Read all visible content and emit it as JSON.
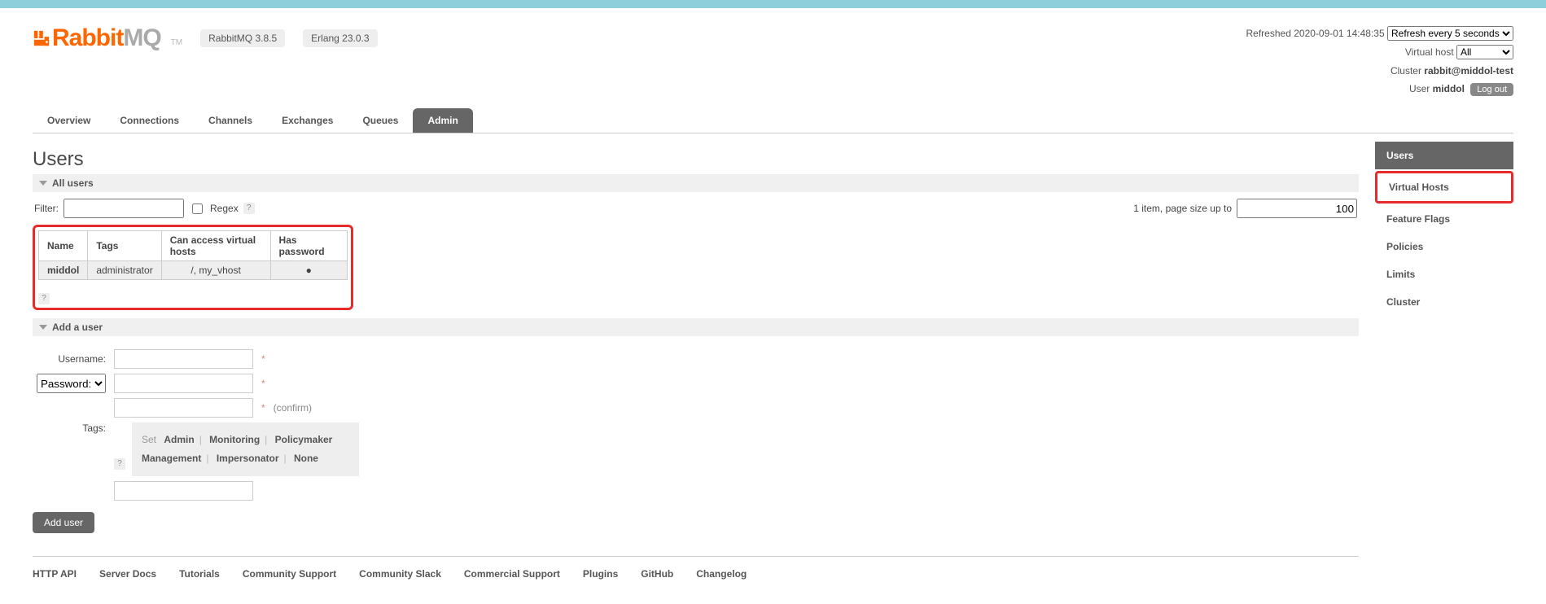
{
  "brand": {
    "rabbit": "Rabbit",
    "mq": "MQ",
    "tm": "TM"
  },
  "versions": {
    "rabbit": "RabbitMQ 3.8.5",
    "erlang": "Erlang 23.0.3"
  },
  "header": {
    "refreshed_label": "Refreshed",
    "refreshed_time": "2020-09-01 14:48:35",
    "refresh_select": "Refresh every 5 seconds",
    "vhost_label": "Virtual host",
    "vhost_value": "All",
    "cluster_label": "Cluster",
    "cluster_value": "rabbit@middol-test",
    "user_label": "User",
    "user_value": "middol",
    "logout": "Log out"
  },
  "nav": {
    "overview": "Overview",
    "connections": "Connections",
    "channels": "Channels",
    "exchanges": "Exchanges",
    "queues": "Queues",
    "admin": "Admin"
  },
  "page_title": "Users",
  "all_users": {
    "title": "All users",
    "filter_label": "Filter:",
    "regex_label": "Regex",
    "count_text": "1 item, page size up to",
    "page_size": "100",
    "cols": {
      "name": "Name",
      "tags": "Tags",
      "vhosts": "Can access virtual hosts",
      "pwd": "Has password"
    },
    "rows": [
      {
        "name": "middol",
        "tags": "administrator",
        "vhosts": "/, my_vhost",
        "pwd": "●"
      }
    ]
  },
  "add_user": {
    "title": "Add a user",
    "username_label": "Username:",
    "password_option": "Password:",
    "confirm_label": "(confirm)",
    "tags_label": "Tags:",
    "set_label": "Set",
    "opts": {
      "admin": "Admin",
      "monitoring": "Monitoring",
      "policymaker": "Policymaker",
      "management": "Management",
      "impersonator": "Impersonator",
      "none": "None"
    },
    "button": "Add user"
  },
  "sidebar": {
    "users": "Users",
    "vhosts": "Virtual Hosts",
    "feature_flags": "Feature Flags",
    "policies": "Policies",
    "limits": "Limits",
    "cluster": "Cluster"
  },
  "footer": {
    "http_api": "HTTP API",
    "server_docs": "Server Docs",
    "tutorials": "Tutorials",
    "community_support": "Community Support",
    "community_slack": "Community Slack",
    "commercial_support": "Commercial Support",
    "plugins": "Plugins",
    "github": "GitHub",
    "changelog": "Changelog"
  }
}
